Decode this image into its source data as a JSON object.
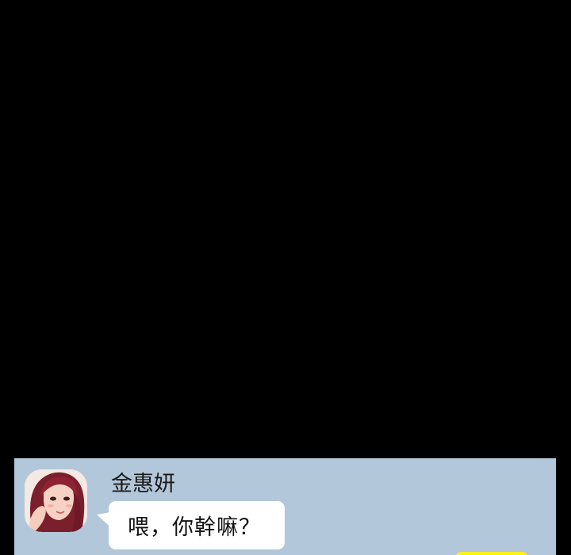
{
  "chat": {
    "sender_name": "金惠妍",
    "message_text": "喂，你幹嘛？"
  },
  "colors": {
    "background": "#000000",
    "chat_background": "#b2c7d9",
    "incoming_bubble": "#ffffff",
    "outgoing_bubble": "#fef01b"
  },
  "icons": {
    "avatar": "profile-avatar-icon"
  }
}
